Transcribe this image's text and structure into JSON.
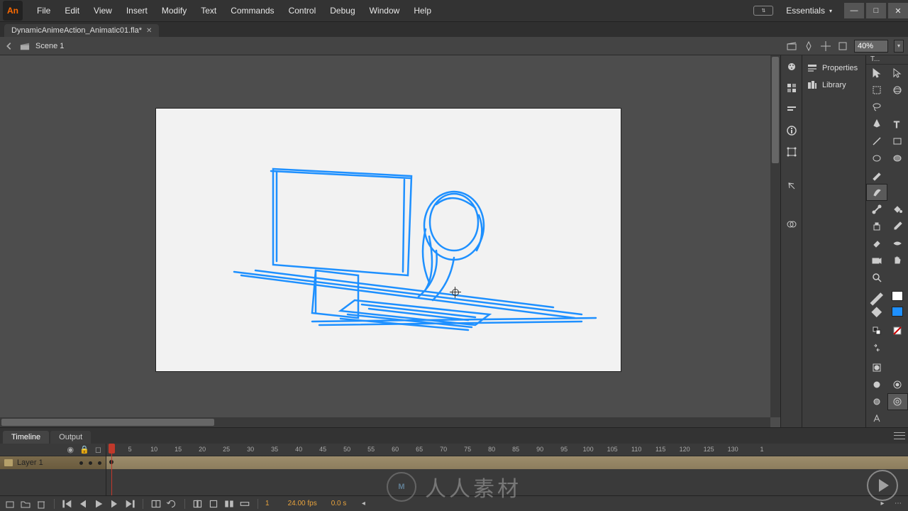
{
  "app": {
    "icon_label": "An",
    "workspace_label": "Essentials"
  },
  "menu": [
    "File",
    "Edit",
    "View",
    "Insert",
    "Modify",
    "Text",
    "Commands",
    "Control",
    "Debug",
    "Window",
    "Help"
  ],
  "document": {
    "tab_title": "DynamicAnimeAction_Animatic01.fla*"
  },
  "scene": {
    "name": "Scene 1",
    "zoom": "40%"
  },
  "panelcol1": {
    "i1": "color-panel-icon",
    "i2": "swatches-panel-icon",
    "i3": "align-panel-icon",
    "i4": "info-panel-icon",
    "i5": "transform-panel-icon",
    "i6": "history-panel-icon",
    "i7": "cc-libraries-icon"
  },
  "panelcol2": {
    "properties": "Properties",
    "library": "Library"
  },
  "tools_header": "T...",
  "tools": {
    "selection": "selection-tool",
    "subselection": "subselection-tool",
    "free-transform": "free-transform-tool",
    "3d-rotation": "3d-rotation-tool",
    "lasso": "lasso-tool",
    "blank1": "",
    "pen": "pen-tool",
    "text": "text-tool",
    "line": "line-tool",
    "rectangle": "rectangle-tool",
    "oval": "oval-tool",
    "polystar": "polystar-tool",
    "pencil": "pencil-tool",
    "brush-blank": "",
    "brush": "brush-tool",
    "active": true,
    "bone": "bone-tool",
    "paint-bucket": "paint-bucket-tool",
    "ink-bottle": "ink-bottle-tool",
    "eyedropper": "eyedropper-tool",
    "eraser": "eraser-tool",
    "width": "width-tool",
    "camera": "camera-tool",
    "hand": "hand-tool",
    "zoom": "zoom-tool"
  },
  "colors": {
    "stroke": "#ffffff",
    "fill": "#1e90ff"
  },
  "timeline": {
    "tab1": "Timeline",
    "tab2": "Output",
    "layer1": "Layer 1",
    "frame_current": "1",
    "fps": "24.00 fps",
    "elapsed": "0.0 s",
    "ruler_marks": [
      1,
      5,
      10,
      15,
      20,
      25,
      30,
      35,
      40,
      45,
      50,
      55,
      60,
      65,
      70,
      75,
      80,
      85,
      90,
      95,
      100,
      105,
      110,
      115,
      120,
      125,
      130
    ],
    "end_mark": "1"
  },
  "watermark": {
    "logo": "M",
    "text": "人人素材"
  }
}
